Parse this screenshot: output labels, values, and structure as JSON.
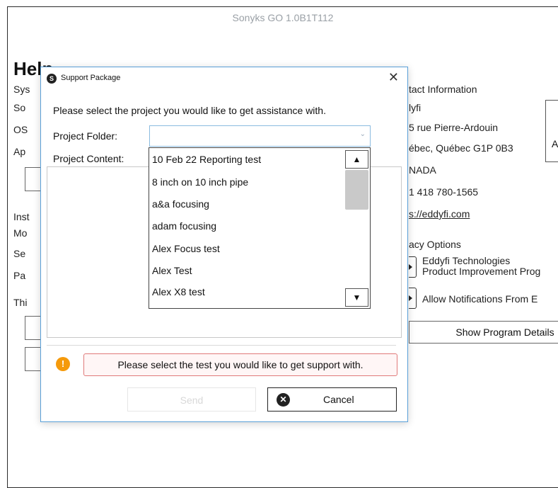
{
  "app": {
    "title": "Sonyks GO 1.0B1T112"
  },
  "help": {
    "title": "Help",
    "left_labels": [
      "Sys",
      "So",
      "OS",
      "Ap",
      "Inst",
      "Mo",
      "Se",
      "Pa",
      "Thi"
    ],
    "contact": {
      "heading": "tact Information",
      "company": "lyfi",
      "address1": "5 rue Pierre-Ardouin",
      "address2": "ébec, Québec  G1P 0B3",
      "country": "NADA",
      "phone": "1 418 780-1565",
      "website": "s://eddyfi.com",
      "side_letter": "A"
    },
    "privacy": {
      "heading": "acy Options",
      "option1_line1": "Eddyfi Technologies",
      "option1_line2": "Product Improvement Prog",
      "option2": "Allow Notifications From E",
      "details_button": "Show Program Details"
    }
  },
  "dialog": {
    "title": "Support Package",
    "close_glyph": "✕",
    "instruction": "Please select the project you would like to get assistance with.",
    "folder_label": "Project Folder:",
    "folder_value": "",
    "content_label": "Project Content:",
    "list_items": [
      "10 Feb 22 Reporting test",
      "8 inch on 10 inch pipe",
      "a&a focusing",
      "adam focusing",
      "Alex Focus test",
      "Alex Test",
      "Alex X8 test"
    ],
    "scroll_up_glyph": "▲",
    "scroll_down_glyph": "▼",
    "warning_icon": "!",
    "warning_text": "Please select the test you would like to get support with.",
    "send_label": "Send",
    "cancel_label": "Cancel",
    "cancel_icon": "✕"
  },
  "colors": {
    "accent": "#5aa0d8",
    "warning": "#f59a0b",
    "error_border": "#e07a7a"
  }
}
